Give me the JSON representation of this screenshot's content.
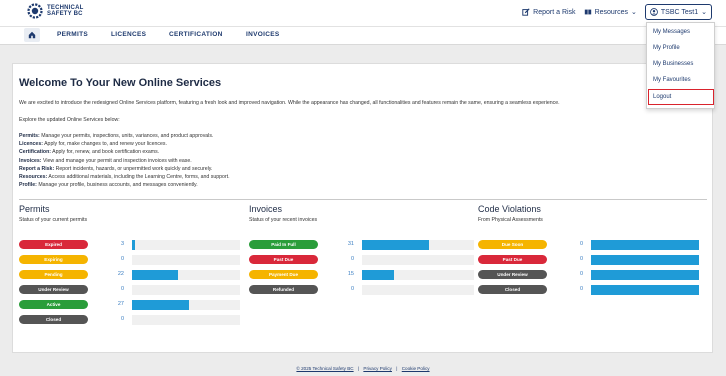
{
  "header": {
    "logo_line1": "TECHNICAL",
    "logo_line2": "SAFETY BC",
    "report_risk": "Report a Risk",
    "resources": "Resources",
    "user": "TSBC Test1"
  },
  "nav": {
    "items": [
      "PERMITS",
      "LICENCES",
      "CERTIFICATION",
      "INVOICES"
    ]
  },
  "user_menu": {
    "items": [
      "My Messages",
      "My Profile",
      "My Businesses",
      "My Favourites"
    ],
    "logout": "Logout"
  },
  "welcome": {
    "title": "Welcome To Your New Online Services",
    "intro": "We are excited to introduce the redesigned Online Services platform, featuring a fresh look and improved navigation. While the appearance has changed, all functionalities and features remain the same, ensuring a seamless experience.",
    "explore": "Explore the updated Online Services below:",
    "definitions": [
      {
        "term": "Permits:",
        "text": "Manage your permits, inspections, units, variances, and product approvals."
      },
      {
        "term": "Licences:",
        "text": "Apply for, make changes to, and renew your licences."
      },
      {
        "term": "Certification:",
        "text": "Apply for, renew, and book certification exams."
      },
      {
        "term": "Invoices:",
        "text": "View and manage your permit and inspection invoices with ease."
      },
      {
        "term": "Report a Risk:",
        "text": "Report incidents, hazards, or unpermitted work quickly and securely."
      },
      {
        "term": "Resources:",
        "text": "Access additional materials, including the Learning Centre, forms, and support."
      },
      {
        "term": "Profile:",
        "text": "Manage your profile, business accounts, and messages conveniently."
      }
    ]
  },
  "panels": {
    "permits": {
      "title": "Permits",
      "subtitle": "Status of your current permits",
      "rows": [
        {
          "label": "Expired",
          "count": "3",
          "color": "#d9283a",
          "fill": 0.03
        },
        {
          "label": "Expiring",
          "count": "0",
          "color": "#f5b400",
          "fill": 0
        },
        {
          "label": "Pending",
          "count": "22",
          "color": "#f5b400",
          "fill": 0.43
        },
        {
          "label": "Under Review",
          "count": "0",
          "color": "#555555",
          "fill": 0
        },
        {
          "label": "Active",
          "count": "27",
          "color": "#2a9d3a",
          "fill": 0.53
        },
        {
          "label": "Closed",
          "count": "0",
          "color": "#555555",
          "fill": 0
        }
      ]
    },
    "invoices": {
      "title": "Invoices",
      "subtitle": "Status of your recent invoices",
      "rows": [
        {
          "label": "Paid In Full",
          "count": "31",
          "color": "#2a9d3a",
          "fill": 0.6
        },
        {
          "label": "Past Due",
          "count": "0",
          "color": "#d9283a",
          "fill": 0
        },
        {
          "label": "Payment Due",
          "count": "15",
          "color": "#f5b400",
          "fill": 0.29
        },
        {
          "label": "Refunded",
          "count": "0",
          "color": "#555555",
          "fill": 0
        }
      ]
    },
    "violations": {
      "title": "Code Violations",
      "subtitle": "From Physical Assessments",
      "rows": [
        {
          "label": "Due Soon",
          "count": "0",
          "color": "#f5b400",
          "fill": 1
        },
        {
          "label": "Past Due",
          "count": "0",
          "color": "#d9283a",
          "fill": 1
        },
        {
          "label": "Under Review",
          "count": "0",
          "color": "#555555",
          "fill": 1
        },
        {
          "label": "Closed",
          "count": "0",
          "color": "#555555",
          "fill": 1
        }
      ]
    }
  },
  "footer": {
    "copyright": "© 2025 Technical Safety BC",
    "sep": "|",
    "privacy": "Privacy Policy",
    "cookie": "Cookie Policy"
  }
}
